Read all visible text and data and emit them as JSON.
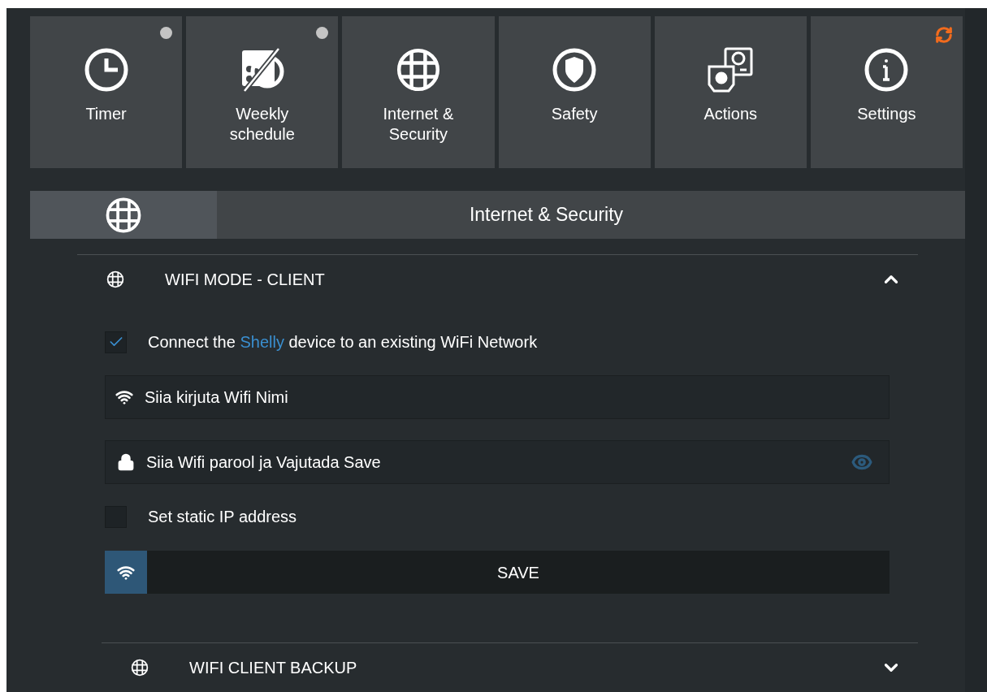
{
  "tiles": [
    {
      "label": "Timer",
      "kind": "clock",
      "has_dot": true,
      "syncing": false
    },
    {
      "label": "Weekly schedule",
      "kind": "schedule",
      "has_dot": true,
      "syncing": false
    },
    {
      "label": "Internet & Security",
      "kind": "globe",
      "has_dot": false,
      "syncing": false
    },
    {
      "label": "Safety",
      "kind": "shield",
      "has_dot": false,
      "syncing": false
    },
    {
      "label": "Actions",
      "kind": "actions",
      "has_dot": false,
      "syncing": false
    },
    {
      "label": "Settings",
      "kind": "info",
      "has_dot": false,
      "syncing": true
    }
  ],
  "panel": {
    "title": "Internet & Security"
  },
  "sections": [
    {
      "title": "WIFI MODE - CLIENT",
      "expanded": true,
      "connect": {
        "checked": true,
        "before": "Connect the ",
        "link": "Shelly",
        "after": " device to an existing WiFi Network"
      },
      "ssid": {
        "value": "Siia kirjuta Wifi Nimi"
      },
      "password": {
        "value": "Siia Wifi parool ja Vajutada Save"
      },
      "static_ip": {
        "checked": false,
        "label": "Set static IP address"
      },
      "save": "SAVE"
    },
    {
      "title": "WIFI CLIENT BACKUP",
      "expanded": false
    }
  ]
}
